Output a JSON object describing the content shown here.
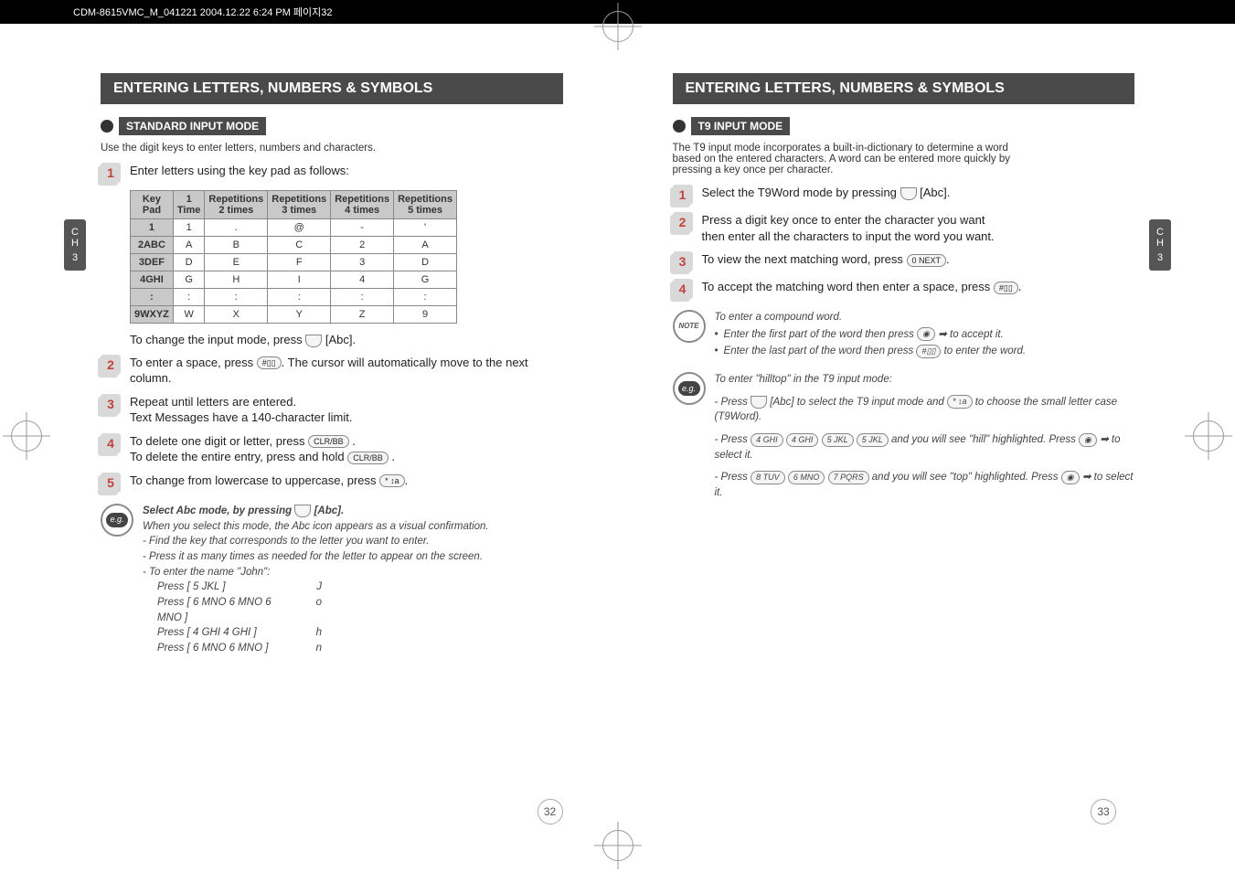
{
  "header": "CDM-8615VMC_M_041221  2004.12.22 6:24 PM  페이지32",
  "chapter_tab": {
    "label1": "C",
    "label2": "H",
    "num": "3"
  },
  "left": {
    "title": "ENTERING LETTERS, NUMBERS & SYMBOLS",
    "mode": "STANDARD INPUT MODE",
    "intro": "Use the digit keys to enter letters, numbers and characters.",
    "step1": "Enter letters using the key pad as follows:",
    "table": {
      "headers": [
        "Key Pad",
        "1 Time",
        "Repetitions 2 times",
        "Repetitions 3 times",
        "Repetitions 4 times",
        "Repetitions 5 times"
      ],
      "rows": [
        [
          "1",
          "1",
          ".",
          "@",
          "-",
          "'"
        ],
        [
          "2ABC",
          "A",
          "B",
          "C",
          "2",
          "A"
        ],
        [
          "3DEF",
          "D",
          "E",
          "F",
          "3",
          "D"
        ],
        [
          "4GHI",
          "G",
          "H",
          "I",
          "4",
          "G"
        ],
        [
          ":",
          ":",
          ":",
          ":",
          ":",
          ":"
        ],
        [
          "9WXYZ",
          "W",
          "X",
          "Y",
          "Z",
          "9"
        ]
      ]
    },
    "after_table": "To change the input mode, press      [Abc].",
    "step2": "To enter a space, press      . The cursor will automatically move to the next column.",
    "step3a": "Repeat until letters are entered.",
    "step3b": "Text Messages have a 140-character limit.",
    "step4a": "To delete one digit or letter, press       .",
    "step4b": "To delete the entire entry, press and hold       .",
    "step5": "To change from lowercase to uppercase, press      .",
    "eg_title": "Select Abc mode, by pressing      [Abc].",
    "eg_p1": "When you select this mode, the Abc icon appears as a visual confirmation.",
    "eg_b1": "- Find the key that corresponds to the letter you want to enter.",
    "eg_b2": "- Press it as many times as needed for the letter to appear on the screen.",
    "eg_b3": "- To enter the name \"John\":",
    "john": [
      {
        "press": "Press [ 5 JKL ]",
        "out": "J"
      },
      {
        "press": "Press [ 6 MNO  6 MNO  6 MNO ]",
        "out": "o"
      },
      {
        "press": "Press [ 4 GHI  4 GHI ]",
        "out": "h"
      },
      {
        "press": "Press [ 6 MNO  6 MNO ]",
        "out": "n"
      }
    ],
    "page_num": "32"
  },
  "right": {
    "title": "ENTERING LETTERS, NUMBERS & SYMBOLS",
    "mode": "T9 INPUT MODE",
    "intro": "The T9 input mode incorporates a built-in-dictionary to determine a word based on the entered characters. A word can be entered more quickly by pressing a key once per character.",
    "step1": "Select the T9Word mode by pressing      [Abc].",
    "step2": "Press a digit key once to enter the character you want then enter all the characters to input the word you want.",
    "step3": "To view the next matching word, press      .",
    "step4": "To accept the matching word then enter a space, press      .",
    "note_title": "To enter a compound word.",
    "note_b1": "Enter the first part of the word then press      to accept it.",
    "note_b2": "Enter the last part of the word then press      to enter the word.",
    "eg_title": "To enter \"hilltop\" in the T9 input mode:",
    "eg_b1": "- Press      [Abc] to select the T9 input mode and       to choose the small letter case (T9Word).",
    "eg_b2": "- Press  4 GHI  4 GHI  5 JKL  5 JKL  and you will see \"hill\" highlighted. Press      to select it.",
    "eg_b3": "- Press  8 TUV  6 MNO  7 PQRS  and you will see \"top\" highlighted. Press      to select it.",
    "page_num": "33"
  }
}
